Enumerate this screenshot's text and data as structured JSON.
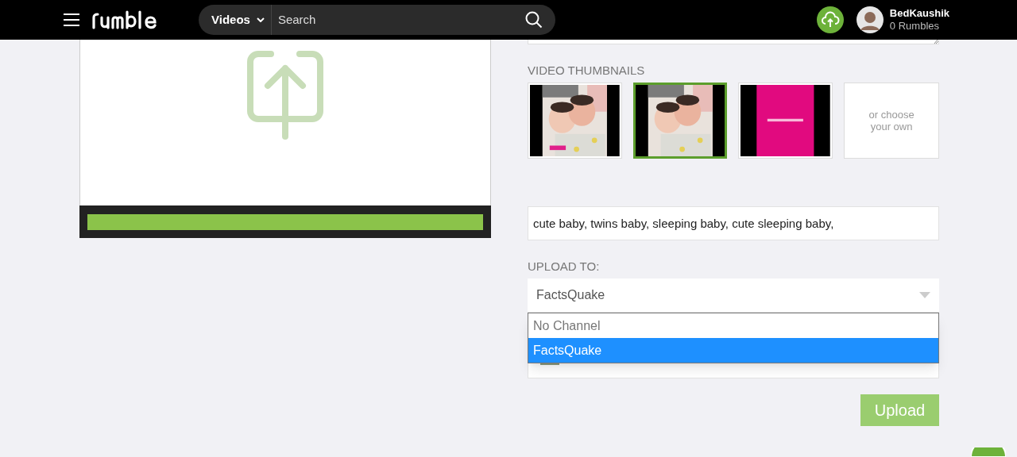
{
  "header": {
    "search_scope": "Videos",
    "search": {
      "placeholder": "Search"
    },
    "user": {
      "name": "BedKaushik",
      "rumbles": "0 Rumbles"
    }
  },
  "thumbnails": {
    "label": "VIDEO THUMBNAILS",
    "items": [
      {
        "kind": "picture",
        "selected": false
      },
      {
        "kind": "picture",
        "selected": true
      },
      {
        "kind": "title-card",
        "selected": false
      },
      {
        "kind": "choose",
        "text": "or choose your own",
        "selected": false
      }
    ]
  },
  "tags": {
    "value": "cute baby, twins baby, sleeping baby, cute sleeping baby,"
  },
  "upload_to": {
    "label": "UPLOAD TO:",
    "value": "FactsQuake",
    "options": [
      {
        "label": "No Channel",
        "selected": false
      },
      {
        "label": "FactsQuake",
        "selected": true
      }
    ]
  },
  "upload_button": "Upload"
}
